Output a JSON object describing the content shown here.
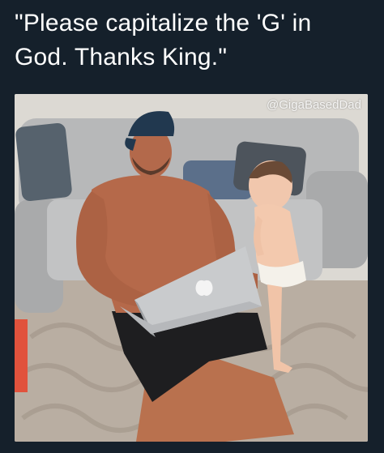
{
  "caption": {
    "line1": "\"Please capitalize the 'G' in",
    "line2": "God. Thanks King.\""
  },
  "image": {
    "watermark": "@GigaBasedDad",
    "subject": "meme-photo"
  }
}
